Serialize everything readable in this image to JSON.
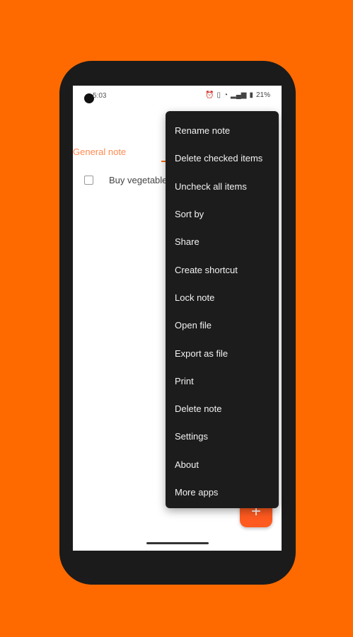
{
  "status_bar": {
    "time": "5:03",
    "battery": "21%",
    "icons": [
      "alarm-icon",
      "vibrate-icon",
      "wifi-icon",
      "signal-icon",
      "battery-icon"
    ]
  },
  "tabs": [
    {
      "label": "General note"
    }
  ],
  "items": [
    {
      "text": "Buy vegetables",
      "checked": false
    }
  ],
  "fab": {
    "label": "+"
  },
  "menu": {
    "items": [
      {
        "label": "Rename note"
      },
      {
        "label": "Delete checked items"
      },
      {
        "label": "Uncheck all items"
      },
      {
        "label": "Sort by"
      },
      {
        "label": "Share"
      },
      {
        "label": "Create shortcut"
      },
      {
        "label": "Lock note"
      },
      {
        "label": "Open file"
      },
      {
        "label": "Export as file"
      },
      {
        "label": "Print"
      },
      {
        "label": "Delete note"
      },
      {
        "label": "Settings"
      },
      {
        "label": "About"
      },
      {
        "label": "More apps"
      }
    ]
  },
  "colors": {
    "accent": "#FF6A00",
    "menu_bg": "#1c1c1c",
    "tab_text": "#FF8A50"
  }
}
